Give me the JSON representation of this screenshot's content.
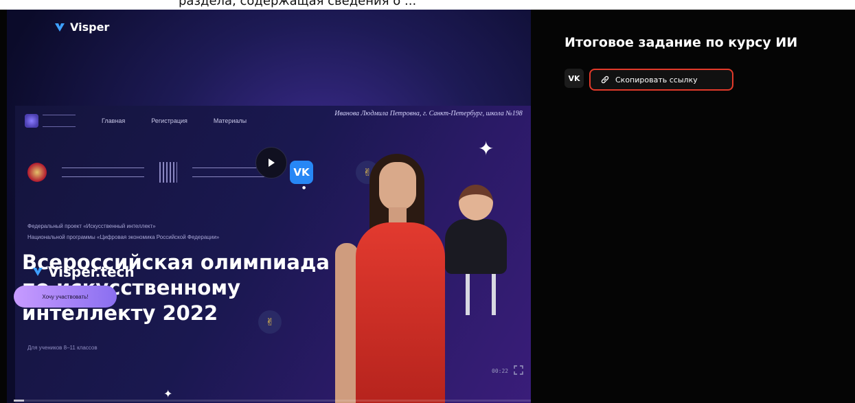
{
  "top_strip": {
    "clipped_text": "раздела, содержащая сведения о ..."
  },
  "video": {
    "brand": "Visper",
    "site": {
      "nav": [
        "Главная",
        "Регистрация",
        "Материалы"
      ],
      "author": "Иванова Людмила Петровна, г. Санкт-Петербург, школа №198",
      "subtitle_lines": [
        "Федеральный проект «Искусственный интеллект»",
        "Национальной программы «Цифровая экономика Российской Федерации»"
      ],
      "title_lines": [
        "Всероссийская олимпиада",
        "по искусственному",
        "интеллекту 2022"
      ],
      "grades": "Для учеников 8–11 классов",
      "cta": "Хочу участвовать!",
      "vk": "VK"
    },
    "watermark": "Visper.tech",
    "timer": "00:22",
    "progress": 0.02,
    "icons": [
      "play-icon",
      "fullscreen-icon",
      "visper-logo-icon"
    ]
  },
  "panel": {
    "heading": "Итоговое задание по курсу ИИ",
    "vk_label": "VK",
    "copy_label": "Скопировать ссылку",
    "highlight_color": "#e33a2a"
  }
}
